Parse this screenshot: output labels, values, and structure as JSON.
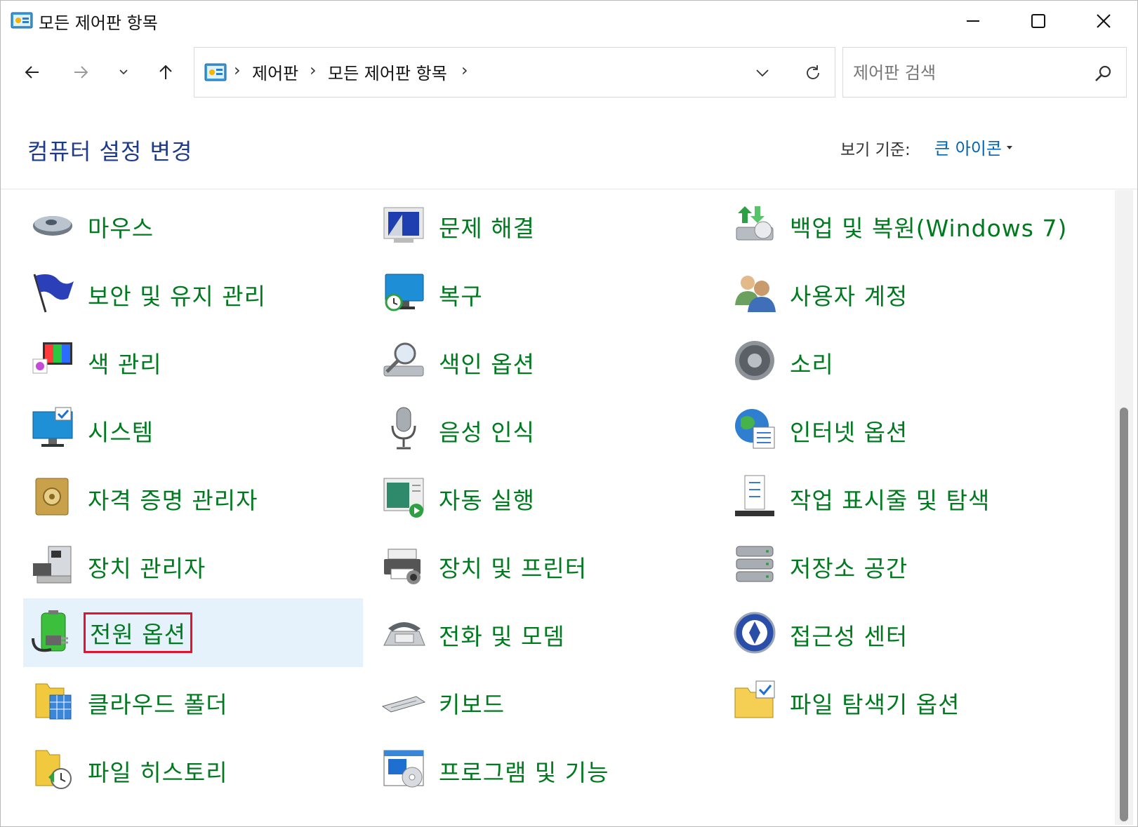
{
  "window": {
    "title": "모든 제어판 항목"
  },
  "navigation": {
    "breadcrumbs": [
      "제어판",
      "모든 제어판 항목"
    ]
  },
  "search": {
    "placeholder": "제어판 검색"
  },
  "header": {
    "title": "컴퓨터 설정 변경",
    "view_by_label": "보기 기준:",
    "view_by_value": "큰 아이콘"
  },
  "items": [
    {
      "label": "마우스",
      "icon": "mouse-icon"
    },
    {
      "label": "문제 해결",
      "icon": "troubleshooting-icon"
    },
    {
      "label": "백업 및 복원(Windows 7)",
      "icon": "backup-restore-icon"
    },
    {
      "label": "보안 및 유지 관리",
      "icon": "security-maintenance-flag-icon"
    },
    {
      "label": "복구",
      "icon": "recovery-icon"
    },
    {
      "label": "사용자 계정",
      "icon": "user-accounts-icon"
    },
    {
      "label": "색 관리",
      "icon": "color-management-icon"
    },
    {
      "label": "색인 옵션",
      "icon": "indexing-options-icon"
    },
    {
      "label": "소리",
      "icon": "sound-icon"
    },
    {
      "label": "시스템",
      "icon": "system-icon"
    },
    {
      "label": "음성 인식",
      "icon": "microphone-icon"
    },
    {
      "label": "인터넷 옵션",
      "icon": "internet-options-icon"
    },
    {
      "label": "자격 증명 관리자",
      "icon": "credential-manager-icon"
    },
    {
      "label": "자동 실행",
      "icon": "autoplay-icon"
    },
    {
      "label": "작업 표시줄 및 탐색",
      "icon": "taskbar-icon"
    },
    {
      "label": "장치 관리자",
      "icon": "device-manager-icon"
    },
    {
      "label": "장치 및 프린터",
      "icon": "devices-printers-icon"
    },
    {
      "label": "저장소 공간",
      "icon": "storage-spaces-icon"
    },
    {
      "label": "전원 옵션",
      "icon": "power-options-icon",
      "selected": true,
      "highlighted": true
    },
    {
      "label": "전화 및 모뎀",
      "icon": "phone-modem-icon"
    },
    {
      "label": "접근성 센터",
      "icon": "ease-of-access-icon"
    },
    {
      "label": "클라우드 폴더",
      "icon": "cloud-folder-icon"
    },
    {
      "label": "키보드",
      "icon": "keyboard-icon"
    },
    {
      "label": "파일 탐색기 옵션",
      "icon": "file-explorer-options-icon"
    },
    {
      "label": "파일 히스토리",
      "icon": "file-history-icon"
    },
    {
      "label": "프로그램 및 기능",
      "icon": "programs-features-icon"
    }
  ],
  "colors": {
    "link_green": "#007a1f",
    "title_blue": "#1e3a8a",
    "accent_blue": "#0063b1",
    "selection": "#e5f1fb",
    "highlight_box": "#e0142c"
  }
}
